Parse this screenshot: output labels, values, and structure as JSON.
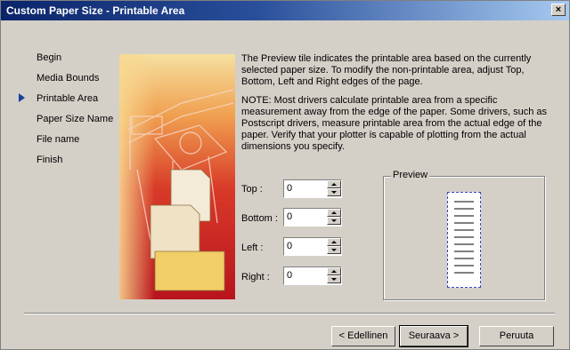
{
  "window": {
    "title": "Custom Paper Size - Printable Area",
    "close_glyph": "×"
  },
  "nav": {
    "items": [
      {
        "label": "Begin",
        "current": false
      },
      {
        "label": "Media Bounds",
        "current": false
      },
      {
        "label": "Printable Area",
        "current": true
      },
      {
        "label": "Paper Size Name",
        "current": false
      },
      {
        "label": "File name",
        "current": false
      },
      {
        "label": "Finish",
        "current": false
      }
    ]
  },
  "description": {
    "p1": "The Preview tile indicates the printable area based on the currently selected paper size. To modify the non-printable area, adjust Top, Bottom, Left and Right edges of the page.",
    "p2": "NOTE: Most drivers calculate printable area from a specific measurement away from the edge of the paper. Some drivers, such as Postscript drivers, measure printable area from the actual edge of the paper. Verify that your plotter is capable of plotting from the actual dimensions you specify."
  },
  "fields": {
    "top": {
      "label": "Top :",
      "value": "0"
    },
    "bottom": {
      "label": "Bottom :",
      "value": "0"
    },
    "left": {
      "label": "Left :",
      "value": "0"
    },
    "right": {
      "label": "Right :",
      "value": "0"
    }
  },
  "preview": {
    "label": "Preview"
  },
  "buttons": {
    "back": "< Edellinen",
    "next": "Seuraava >",
    "cancel": "Peruuta"
  },
  "colors": {
    "title_start": "#0a246a",
    "title_end": "#a6caf0",
    "accent": "#1a3fa0",
    "art_red": "#c81e1e",
    "art_yellow": "#f0c85a"
  }
}
